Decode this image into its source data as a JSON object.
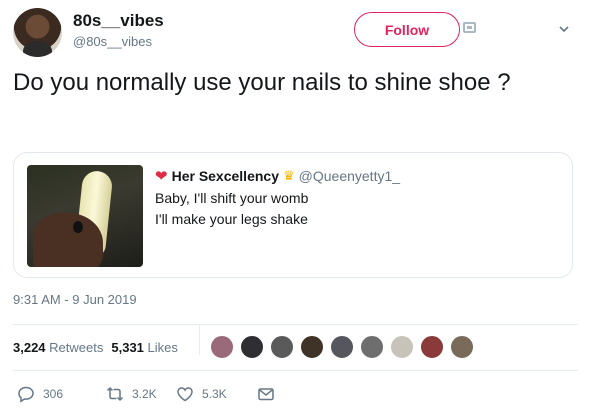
{
  "user": {
    "display_name": "80s__vibes",
    "handle": "@80s__vibes",
    "follow_label": "Follow"
  },
  "tweet": {
    "text": "Do you normally use your nails to shine shoe ?"
  },
  "quote": {
    "name": "Her Sexcellency",
    "name_emoji_before": "❤",
    "name_emoji_after": "♛",
    "handle": "@Queenyetty1_",
    "lines": [
      "Baby, I'll shift your womb",
      "I'll make your legs shake"
    ]
  },
  "timestamp": "9:31 AM - 9 Jun 2019",
  "stats": {
    "retweets_count": "3,224",
    "retweets_label": "Retweets",
    "likes_count": "5,331",
    "likes_label": "Likes"
  },
  "liker_avatar_colors": [
    "#9a6a7a",
    "#2f2f33",
    "#5a5a5a",
    "#3e3326",
    "#56575e",
    "#6e6e6e",
    "#c8c3b8",
    "#8a3a3a",
    "#7a6a5a"
  ],
  "actions": {
    "reply_count": "306",
    "retweet_count": "3.2K",
    "like_count": "5.3K"
  },
  "colors": {
    "follow_accent": "#e0245e",
    "secondary_text": "#657786",
    "icon_gray": "#657786"
  },
  "icons": [
    "app-icon",
    "chevron-down-icon",
    "reply-icon",
    "retweet-icon",
    "like-icon",
    "message-icon"
  ]
}
